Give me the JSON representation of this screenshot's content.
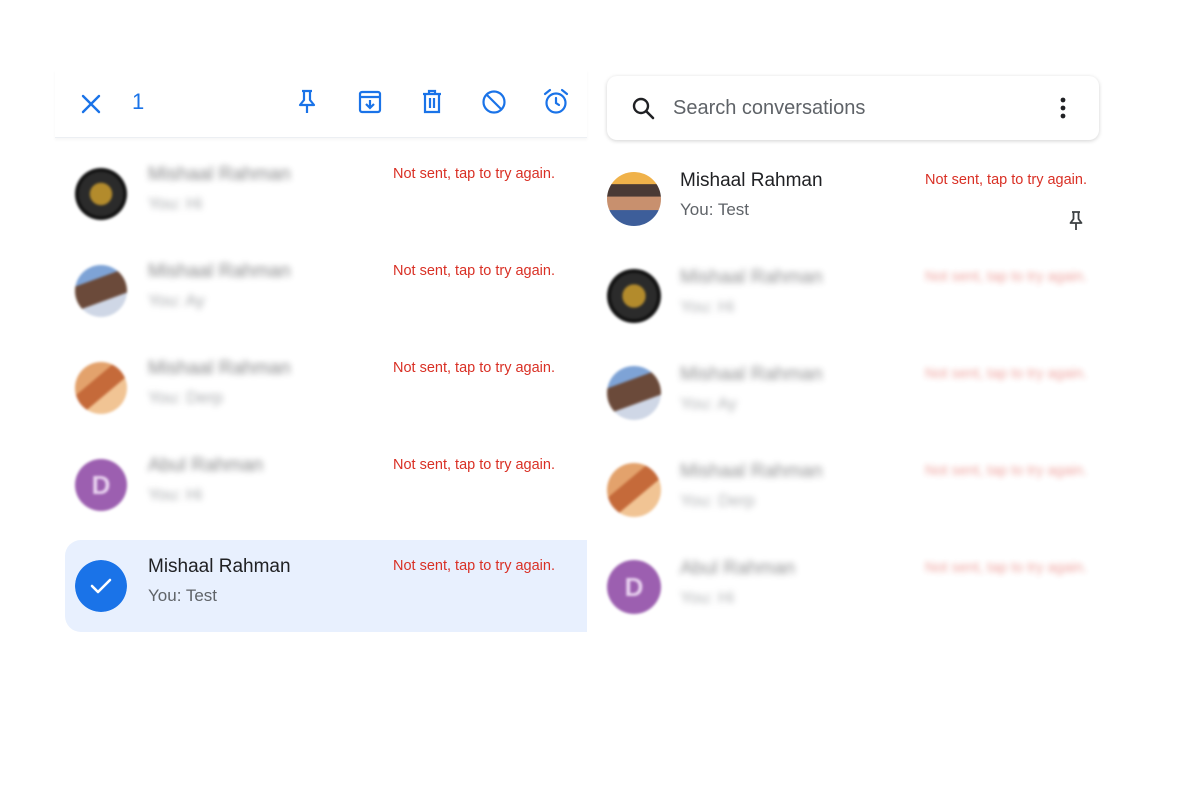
{
  "selection_toolbar": {
    "selected_count": "1",
    "actions": [
      "close-icon",
      "pin-icon",
      "archive-icon",
      "delete-icon",
      "block-icon",
      "snooze-icon"
    ]
  },
  "left_list": {
    "rows": [
      {
        "name": "Mishaal Rahman",
        "snippet": "You: Hi",
        "status": "Not sent, tap to try again.",
        "avatar": "gold-avatar",
        "blurred": true
      },
      {
        "name": "Mishaal Rahman",
        "snippet": "You: Ay",
        "status": "Not sent, tap to try again.",
        "avatar": "photo-avatar",
        "blurred": true
      },
      {
        "name": "Mishaal Rahman",
        "snippet": "You: Derp",
        "status": "Not sent, tap to try again.",
        "avatar": "cartoon-avatar",
        "blurred": true
      },
      {
        "name": "Abul Rahman",
        "snippet": "You: Hi",
        "status": "Not sent, tap to try again.",
        "avatar": "letter-avatar",
        "blurred": true
      },
      {
        "name": "Mishaal Rahman",
        "snippet": "You: Test",
        "status": "Not sent, tap to try again.",
        "avatar": "check-icon",
        "blurred": false,
        "selected": true
      }
    ]
  },
  "search": {
    "placeholder": "Search conversations"
  },
  "right_list": {
    "rows": [
      {
        "name": "Mishaal Rahman",
        "snippet": "You: Test",
        "status": "Not sent, tap to try again.",
        "pinned": true,
        "blurred": false
      },
      {
        "name": "Mishaal Rahman",
        "snippet": "You: Hi",
        "status": "Not sent, tap to try again.",
        "blurred": true
      },
      {
        "name": "Mishaal Rahman",
        "snippet": "You: Ay",
        "status": "Not sent, tap to try again.",
        "blurred": true
      },
      {
        "name": "Mishaal Rahman",
        "snippet": "You: Derp",
        "status": "Not sent, tap to try again.",
        "blurred": true
      },
      {
        "name": "Abul Rahman",
        "snippet": "You: Hi",
        "status": "Not sent, tap to try again.",
        "blurred": true
      }
    ]
  },
  "colors": {
    "accent": "#1a73e8",
    "error": "#d93025",
    "selected_bg": "#e8f0fe"
  }
}
